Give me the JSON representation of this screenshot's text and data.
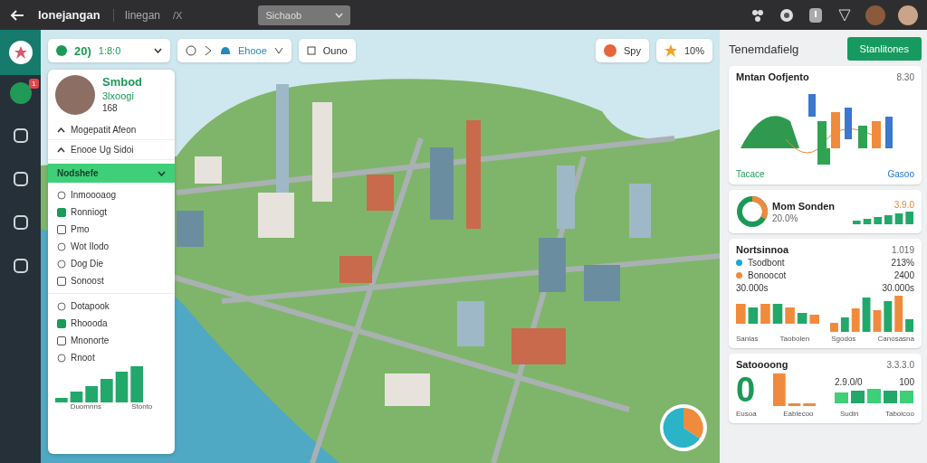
{
  "topbar": {
    "title": "Ionejangan",
    "subtitle": "Iinegan",
    "shortcut": "/X",
    "dropdown": "Sichaob"
  },
  "rail": {
    "badge": "1"
  },
  "hud": {
    "count": "20)",
    "time": "1:8:0",
    "tool_label": "Ehooe",
    "chip_label": "Ouno"
  },
  "hud_right": [
    {
      "label": "Spy"
    },
    {
      "label": "10%"
    }
  ],
  "profile": {
    "name": "Smbod",
    "role": "3lxoogi",
    "level": "168"
  },
  "sections": [
    {
      "label": "Mogepatit Afeon"
    },
    {
      "label": "Enooe Ug Sidoi"
    }
  ],
  "group": {
    "label": "Nodshefe",
    "expanded": true
  },
  "items": [
    {
      "kind": "plain",
      "label": "Inmoooaog"
    },
    {
      "kind": "checkbox",
      "label": "Ronniogt",
      "checked": true
    },
    {
      "kind": "checkbox",
      "label": "Pmo",
      "checked": false
    },
    {
      "kind": "plain",
      "label": "Wot Ilodo"
    },
    {
      "kind": "plain",
      "label": "Dog Die"
    },
    {
      "kind": "checkbox",
      "label": "Sonoost",
      "checked": false
    }
  ],
  "items2": [
    {
      "kind": "plain",
      "label": "Dotapook"
    },
    {
      "kind": "checkbox",
      "label": "Rhoooda",
      "checked": true
    },
    {
      "kind": "checkbox",
      "label": "Mnonorte",
      "checked": false
    },
    {
      "kind": "plain",
      "label": "Rnoot"
    }
  ],
  "mini_chart": {
    "labels": [
      "Duomnns",
      "Stonto"
    ]
  },
  "right": {
    "title": "Tenemdafielg",
    "button": "Stanlitones"
  },
  "cards": [
    {
      "kind": "diagram",
      "title": "Mntan Oofjento",
      "value": "8.30",
      "notes": [
        "Tacace",
        "Gasoo"
      ]
    },
    {
      "kind": "donut",
      "title": "Mom Sonden",
      "value": "3.9.0",
      "percent": "20.0%"
    },
    {
      "kind": "bars",
      "title": "Nortsinnoa",
      "value": "1.019",
      "legend": [
        {
          "label": "Tsodbont",
          "value": "213%",
          "color": "#1aa9d6"
        },
        {
          "label": "Bonoocot",
          "value": "2400",
          "color": "#f08a3c"
        }
      ],
      "captions": [
        "30.000s",
        "30.000s"
      ],
      "labels": [
        "Sanlas",
        "Taobolen",
        "Sgodos",
        "Canosasna"
      ]
    },
    {
      "kind": "score",
      "title": "Satoooong",
      "value": "3.3.3.0",
      "big": "0",
      "captions": [
        "2.9.0/0",
        "100"
      ],
      "labels": [
        "Eusoa",
        "Eablecoo",
        "Sudin",
        "Taboicoo"
      ]
    }
  ]
}
